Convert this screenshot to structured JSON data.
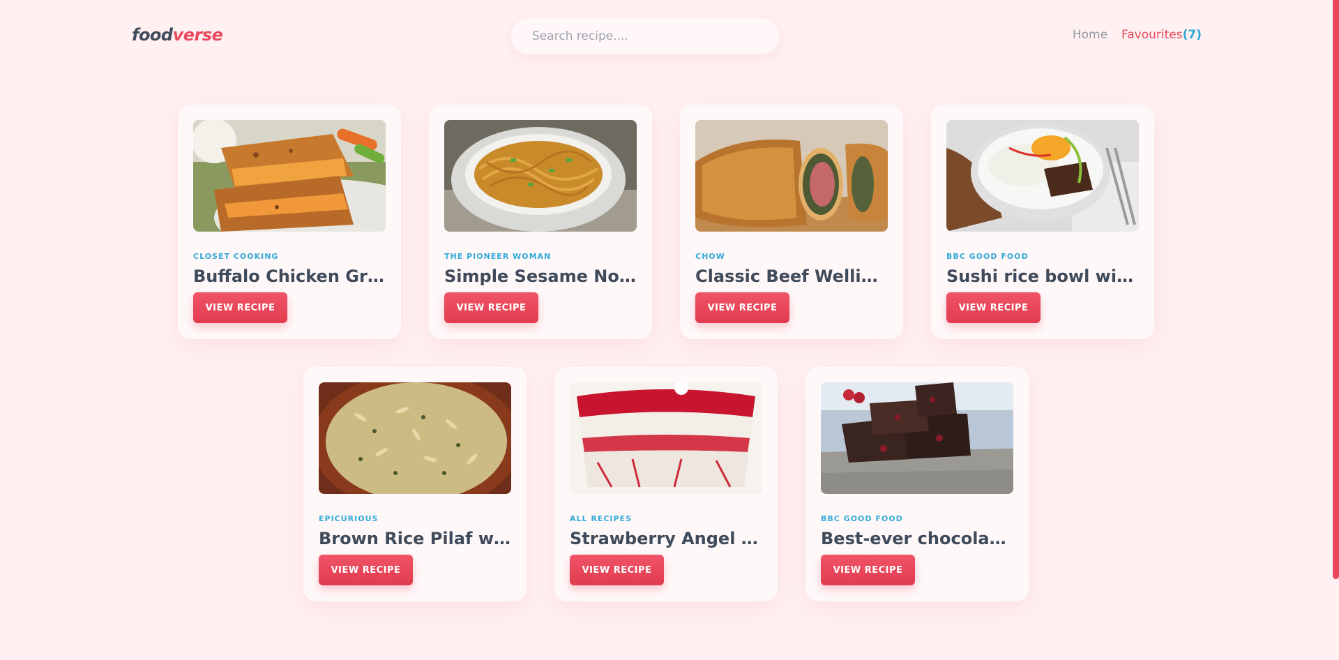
{
  "header": {
    "logo_part1": "food",
    "logo_part2": "verse",
    "search_placeholder": "Search recipe....",
    "nav_home": "Home",
    "nav_favourites": "Favourites",
    "nav_favourites_count": "(7)"
  },
  "colors": {
    "background": "#fff0f1",
    "accent": "#e8475c",
    "publisher": "#34a9d9",
    "title": "#3f4a5a"
  },
  "recipes": [
    {
      "publisher": "CLOSET COOKING",
      "title": "Buffalo Chicken Grilled Cheese Sandwich",
      "button": "VIEW RECIPE",
      "image": "grilled-sandwich-photo"
    },
    {
      "publisher": "THE PIONEER WOMAN",
      "title": "Simple Sesame Noodles",
      "button": "VIEW RECIPE",
      "image": "sesame-noodles-photo"
    },
    {
      "publisher": "CHOW",
      "title": "Classic Beef Wellington",
      "button": "VIEW RECIPE",
      "image": "beef-wellington-photo"
    },
    {
      "publisher": "BBC GOOD FOOD",
      "title": "Sushi rice bowl with beef",
      "button": "VIEW RECIPE",
      "image": "sushi-rice-bowl-photo"
    },
    {
      "publisher": "EPICURIOUS",
      "title": "Brown Rice Pilaf with Almonds",
      "button": "VIEW RECIPE",
      "image": "rice-pilaf-photo"
    },
    {
      "publisher": "ALL RECIPES",
      "title": "Strawberry Angel Food Dessert",
      "button": "VIEW RECIPE",
      "image": "strawberry-trifle-photo"
    },
    {
      "publisher": "BBC GOOD FOOD",
      "title": "Best-ever chocolate raspberry brownies",
      "button": "VIEW RECIPE",
      "image": "brownies-photo"
    }
  ]
}
